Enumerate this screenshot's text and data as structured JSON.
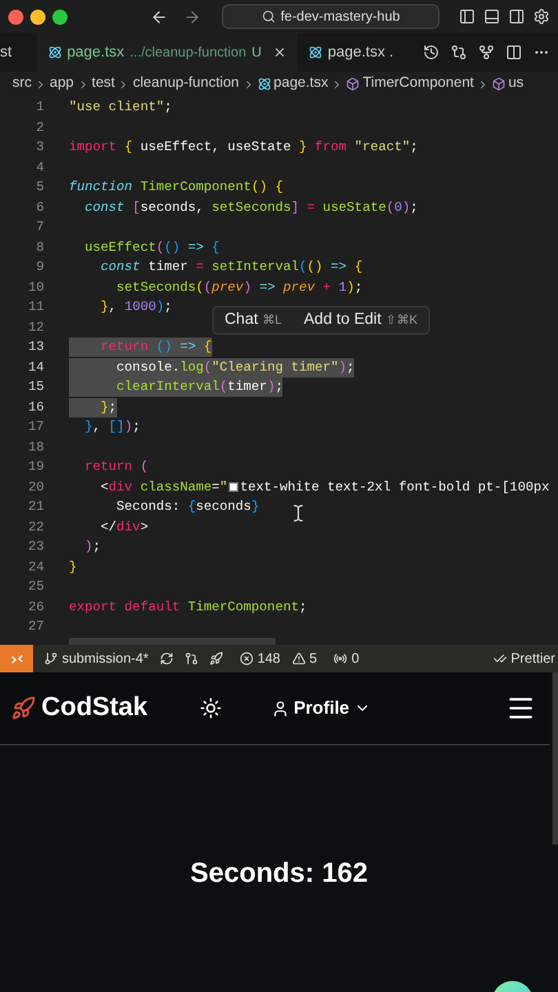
{
  "window": {
    "search": "fe-dev-mastery-hub"
  },
  "tabs": [
    {
      "label": "st",
      "selected": false
    },
    {
      "label": "page.tsx",
      "description": ".../cleanup-function",
      "status": "U",
      "selected": true
    },
    {
      "label": "page.tsx .",
      "selected": false
    }
  ],
  "breadcrumbs": [
    {
      "label": "src",
      "kind": "folder"
    },
    {
      "label": "app",
      "kind": "folder"
    },
    {
      "label": "test",
      "kind": "folder"
    },
    {
      "label": "cleanup-function",
      "kind": "folder"
    },
    {
      "label": "page.tsx",
      "kind": "file"
    },
    {
      "label": "TimerComponent",
      "kind": "symbol"
    },
    {
      "label": "us",
      "kind": "symbol"
    }
  ],
  "editor": {
    "lines": [
      {
        "number": "1",
        "selected": false,
        "tokens": [
          {
            "text": "\"use client\"",
            "kind": "str"
          },
          {
            "text": ";",
            "kind": "p"
          }
        ]
      },
      {
        "number": "2",
        "selected": false
      },
      {
        "number": "3",
        "selected": false,
        "tokens": [
          {
            "text": "import ",
            "kind": "kw"
          },
          {
            "text": "{",
            "kind": "b1"
          },
          {
            "text": " useEffect, useState ",
            "kind": "p"
          },
          {
            "text": "}",
            "kind": "b1"
          },
          {
            "text": " from ",
            "kind": "kw"
          },
          {
            "text": "\"react\"",
            "kind": "str"
          },
          {
            "text": ";",
            "kind": "p"
          }
        ]
      },
      {
        "number": "4",
        "selected": false
      },
      {
        "number": "5",
        "selected": false,
        "tokens": [
          {
            "text": "function ",
            "kind": "st"
          },
          {
            "text": "TimerComponent",
            "kind": "fn"
          },
          {
            "text": "() {",
            "kind": "b1"
          }
        ]
      },
      {
        "number": "6",
        "selected": false,
        "tokens": [
          {
            "text": "  const ",
            "kind": "st"
          },
          {
            "text": "[",
            "kind": "b2"
          },
          {
            "text": "seconds, ",
            "kind": "p"
          },
          {
            "text": "setSeconds",
            "kind": "fn"
          },
          {
            "text": "]",
            "kind": "b2"
          },
          {
            "text": " = ",
            "kind": "kw"
          },
          {
            "text": "useState",
            "kind": "fn"
          },
          {
            "text": "(",
            "kind": "b2"
          },
          {
            "text": "0",
            "kind": "num"
          },
          {
            "text": ")",
            "kind": "b2"
          },
          {
            "text": ";",
            "kind": "p"
          }
        ]
      },
      {
        "number": "7",
        "selected": false
      },
      {
        "number": "8",
        "selected": false,
        "tokens": [
          {
            "text": "  useEffect",
            "kind": "fn"
          },
          {
            "text": "(",
            "kind": "b2"
          },
          {
            "text": "()",
            "kind": "b3"
          },
          {
            "text": " => ",
            "kind": "st"
          },
          {
            "text": "{",
            "kind": "b3"
          }
        ]
      },
      {
        "number": "9",
        "selected": false,
        "tokens": [
          {
            "text": "    const",
            "kind": "st"
          },
          {
            "text": " timer ",
            "kind": "p"
          },
          {
            "text": "= ",
            "kind": "kw"
          },
          {
            "text": "setInterval",
            "kind": "fn"
          },
          {
            "text": "(",
            "kind": "b3"
          },
          {
            "text": "()",
            "kind": "b1"
          },
          {
            "text": " => ",
            "kind": "st"
          },
          {
            "text": "{",
            "kind": "b1"
          }
        ]
      },
      {
        "number": "10",
        "selected": false,
        "tokens": [
          {
            "text": "      setSeconds",
            "kind": "fn"
          },
          {
            "text": "(",
            "kind": "b1"
          },
          {
            "text": "(",
            "kind": "b2"
          },
          {
            "text": "prev",
            "kind": "param"
          },
          {
            "text": ")",
            "kind": "b2"
          },
          {
            "text": " => ",
            "kind": "st"
          },
          {
            "text": "prev ",
            "kind": "param"
          },
          {
            "text": "+ ",
            "kind": "kw"
          },
          {
            "text": "1",
            "kind": "num"
          },
          {
            "text": ")",
            "kind": "b1"
          },
          {
            "text": ";",
            "kind": "p"
          }
        ]
      },
      {
        "number": "11",
        "selected": false,
        "tokens": [
          {
            "text": "    }",
            "kind": "b1"
          },
          {
            "text": ", ",
            "kind": "p"
          },
          {
            "text": "1000",
            "kind": "num"
          },
          {
            "text": ")",
            "kind": "b3"
          },
          {
            "text": ";",
            "kind": "p"
          }
        ]
      },
      {
        "number": "12",
        "selected": false
      },
      {
        "number": "13",
        "selected": true,
        "tokens": [
          {
            "text": "    return ",
            "kind": "kw"
          },
          {
            "text": "()",
            "kind": "b3"
          },
          {
            "text": " => ",
            "kind": "st"
          },
          {
            "text": "{",
            "kind": "b1"
          }
        ]
      },
      {
        "number": "14",
        "selected": true,
        "tokens": [
          {
            "text": "      console.",
            "kind": "p"
          },
          {
            "text": "log",
            "kind": "fn"
          },
          {
            "text": "(",
            "kind": "b2"
          },
          {
            "text": "\"Clearing timer\"",
            "kind": "str"
          },
          {
            "text": ")",
            "kind": "b2"
          },
          {
            "text": ";",
            "kind": "p"
          }
        ]
      },
      {
        "number": "15",
        "selected": true,
        "tokens": [
          {
            "text": "      clearInterval",
            "kind": "fn"
          },
          {
            "text": "(",
            "kind": "b2"
          },
          {
            "text": "timer",
            "kind": "p"
          },
          {
            "text": ")",
            "kind": "b2"
          },
          {
            "text": ";",
            "kind": "p"
          }
        ]
      },
      {
        "number": "16",
        "selected": true,
        "tokens": [
          {
            "text": "    }",
            "kind": "b1"
          },
          {
            "text": ";",
            "kind": "p"
          }
        ]
      },
      {
        "number": "17",
        "selected": false,
        "tokens": [
          {
            "text": "  }",
            "kind": "b3"
          },
          {
            "text": ", ",
            "kind": "p"
          },
          {
            "text": "[]",
            "kind": "b3"
          },
          {
            "text": ")",
            "kind": "b2"
          },
          {
            "text": ";",
            "kind": "p"
          }
        ]
      },
      {
        "number": "18",
        "selected": false
      },
      {
        "number": "19",
        "selected": false,
        "tokens": [
          {
            "text": "  return ",
            "kind": "kw"
          },
          {
            "text": "(",
            "kind": "b2"
          }
        ]
      },
      {
        "number": "20",
        "selected": false,
        "tokens": [
          {
            "text": "    <",
            "kind": "p"
          },
          {
            "text": "div",
            "kind": "kw"
          },
          {
            "text": " className",
            "kind": "fn"
          },
          {
            "text": "=",
            "kind": "p"
          },
          {
            "text": "\"",
            "kind": "str"
          },
          {
            "kind": "swatch",
            "color": "#ffffff"
          },
          {
            "text": "text-white text-2xl font-bold pt-[100px",
            "kind": "p"
          }
        ]
      },
      {
        "number": "21",
        "selected": false,
        "tokens": [
          {
            "text": "      Seconds: ",
            "kind": "p"
          },
          {
            "text": "{",
            "kind": "b3"
          },
          {
            "text": "seconds",
            "kind": "p"
          },
          {
            "text": "}",
            "kind": "b3"
          }
        ]
      },
      {
        "number": "22",
        "selected": false,
        "tokens": [
          {
            "text": "    </",
            "kind": "p"
          },
          {
            "text": "div",
            "kind": "kw"
          },
          {
            "text": ">",
            "kind": "p"
          }
        ]
      },
      {
        "number": "23",
        "selected": false,
        "tokens": [
          {
            "text": "  )",
            "kind": "b2"
          },
          {
            "text": ";",
            "kind": "p"
          }
        ]
      },
      {
        "number": "24",
        "selected": false,
        "tokens": [
          {
            "text": "}",
            "kind": "b1"
          }
        ]
      },
      {
        "number": "25",
        "selected": false
      },
      {
        "number": "26",
        "selected": false,
        "tokens": [
          {
            "text": "export default ",
            "kind": "kw"
          },
          {
            "text": "TimerComponent",
            "kind": "fn"
          },
          {
            "text": ";",
            "kind": "p"
          }
        ]
      },
      {
        "number": "27",
        "selected": false
      }
    ],
    "popup": [
      {
        "label": "Chat",
        "shortcut": "⌘L"
      },
      {
        "label": "Add to Edit",
        "shortcut": "⇧⌘K"
      }
    ]
  },
  "status_bar": {
    "branch": "submission-4*",
    "errors": "148",
    "warnings": "5",
    "ports": "0",
    "formatter": "Prettier"
  },
  "preview": {
    "brand": "CodStak",
    "profile": "Profile",
    "content": "Seconds: 162"
  }
}
